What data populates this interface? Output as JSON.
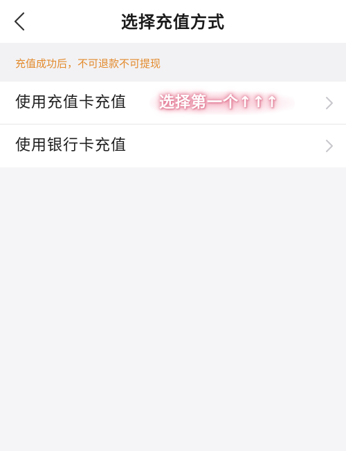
{
  "nav": {
    "title": "选择充值方式",
    "back_icon": "chevron-left-icon"
  },
  "notice": {
    "text": "充值成功后，不可退款不可提现",
    "color": "#e38a2c"
  },
  "options": [
    {
      "label": "使用充值卡充值",
      "icon": "chevron-right-icon"
    },
    {
      "label": "使用银行卡充值",
      "icon": "chevron-right-icon"
    }
  ],
  "annotation": {
    "text": "选择第一个↑↑↑",
    "color": "#e07a95"
  }
}
